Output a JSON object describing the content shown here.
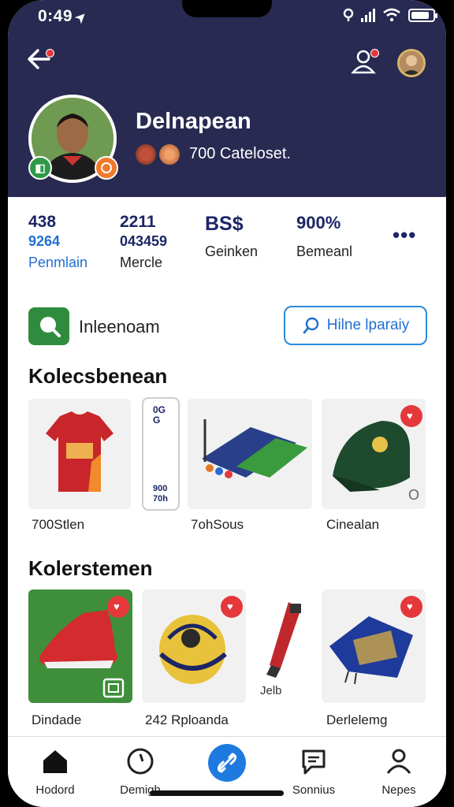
{
  "status_bar": {
    "time": "0:49",
    "battery_level": 0.85
  },
  "header": {
    "back_icon": "arrow-left-icon",
    "user_icon": "user-icon"
  },
  "profile": {
    "name": "Delnapean",
    "subtitle": "700 Cateloset."
  },
  "stats": [
    {
      "value1": "438",
      "value2": "9264",
      "label": "Penmlain",
      "label_color": "#1f6fd1"
    },
    {
      "value1": "2211",
      "value2": "043459",
      "label": "Mercle",
      "label_color": "#222222"
    },
    {
      "value1": "BS$",
      "value2": "",
      "label": "Geinken",
      "label_color": "#222222"
    },
    {
      "value1": "900%",
      "value2": "",
      "label": "Bemeanl",
      "label_color": "#222222"
    }
  ],
  "search": {
    "label": "Inleenoam",
    "button_label": "Hilne lparaiy"
  },
  "section1": {
    "title": "Kolecsbenean",
    "items": [
      {
        "label": "700Stlen"
      },
      {
        "label": ""
      },
      {
        "label": "7ohSous"
      },
      {
        "label": "Cinealan"
      }
    ],
    "narrow_card_top": "0G\nG",
    "narrow_card_bottom": "900\n70h"
  },
  "section2": {
    "title": "Kolerstemen",
    "items": [
      {
        "label": "Dindade"
      },
      {
        "label": "242 Rploanda"
      },
      {
        "label": ""
      },
      {
        "label": "Derlelemg"
      }
    ],
    "inline_caption": "Jelb"
  },
  "bottom_nav": [
    {
      "label": "Hodord",
      "icon": "home-icon"
    },
    {
      "label": "Demigh",
      "icon": "clock-icon"
    },
    {
      "label": "",
      "icon": "link-icon"
    },
    {
      "label": "Sonnius",
      "icon": "chat-icon"
    },
    {
      "label": "Nepes",
      "icon": "person-icon"
    }
  ],
  "colors": {
    "header_bg": "#292a52",
    "accent_blue": "#1f6fd1",
    "green": "#2f8c3e",
    "fav_red": "#e5383b"
  }
}
